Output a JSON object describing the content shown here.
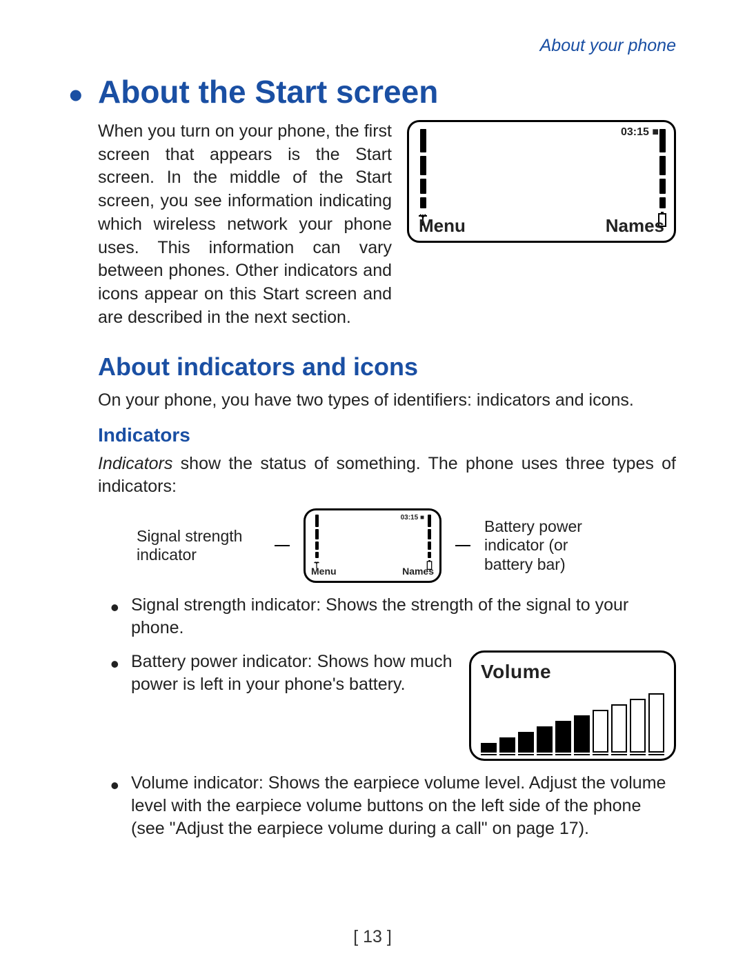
{
  "header": {
    "running": "About your phone"
  },
  "section": {
    "title": "About the Start screen",
    "intro": "When you turn on your phone, the first screen that appears is the Start screen. In the middle of the Start screen, you see information indicating which wireless network your phone uses. This information can vary between phones. Other indicators and icons appear on this Start screen and are described in the next section."
  },
  "subsection": {
    "title": "About indicators and icons",
    "para": "On your phone, you have two types of identifiers: indicators and icons."
  },
  "indicators": {
    "title": "Indicators",
    "intro_prefix_italic": "Indicators",
    "intro_rest": " show the status of something. The phone uses three types of indicators:",
    "fig": {
      "left_label": "Signal strength indicator",
      "right_label": "Battery power indicator (or battery bar)"
    },
    "bullets": [
      "Signal strength indicator: Shows the strength of the signal to your phone.",
      "Battery power indicator: Shows how much power is left in your phone's battery.",
      "Volume indicator: Shows the earpiece volume level.  Adjust the volume level with the earpiece volume buttons on the left side of the phone (see \"Adjust the earpiece volume during a call\" on page 17)."
    ]
  },
  "phoneScreen": {
    "time": "03:15",
    "menu": "Menu",
    "names": "Names"
  },
  "volume": {
    "title": "Volume",
    "filled": 6,
    "total": 10
  },
  "footer": {
    "page": "[ 13 ]"
  }
}
